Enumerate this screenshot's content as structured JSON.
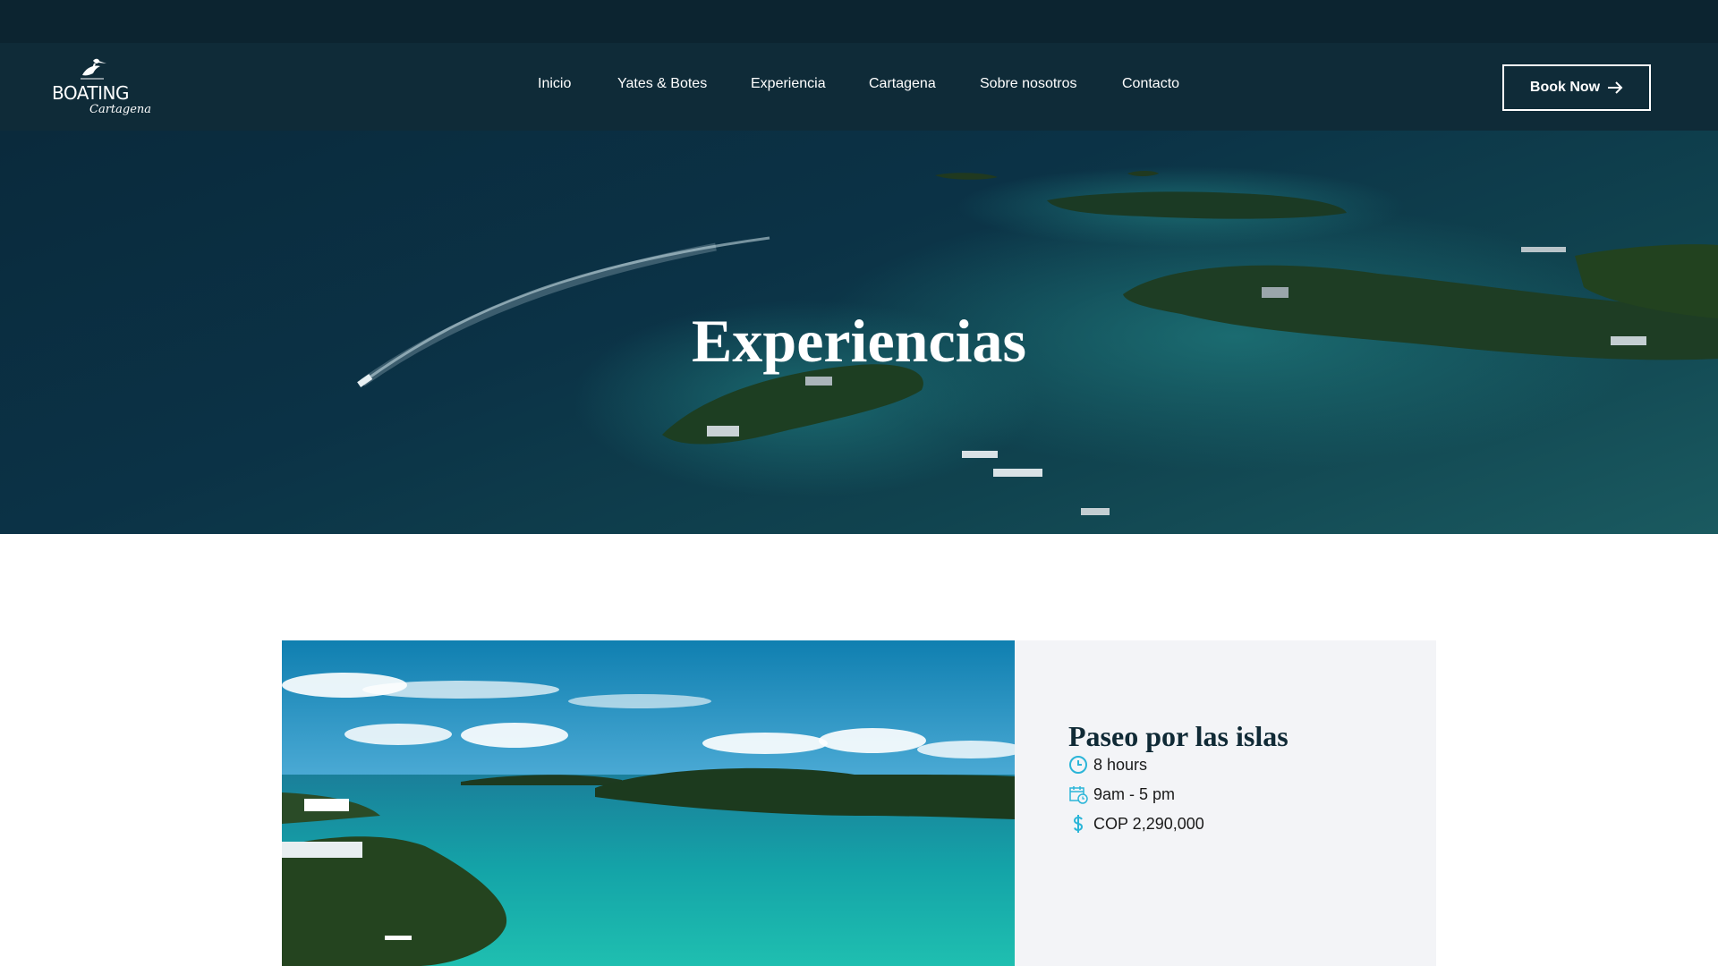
{
  "brand": {
    "logo_word": "BOATING",
    "logo_script": "Cartagena"
  },
  "nav": {
    "items": [
      {
        "label": "Inicio"
      },
      {
        "label": "Yates & Botes"
      },
      {
        "label": "Experiencia"
      },
      {
        "label": "Cartagena"
      },
      {
        "label": "Sobre nosotros"
      },
      {
        "label": "Contacto"
      }
    ],
    "book_label": "Book Now"
  },
  "hero": {
    "title": "Experiencias"
  },
  "experience": {
    "title": "Paseo por las islas",
    "duration": "8 hours",
    "schedule": "9am - 5 pm",
    "price": "COP 2,290,000"
  },
  "colors": {
    "topstrip": "#0c2430",
    "navbar": "#0f2b38",
    "accent_icon": "#2bb5d8",
    "info_panel": "#f3f4f7"
  },
  "icons": {
    "duration": "clock-icon",
    "schedule": "calendar-clock-icon",
    "price": "dollar-icon",
    "book": "arrow-right-icon"
  }
}
